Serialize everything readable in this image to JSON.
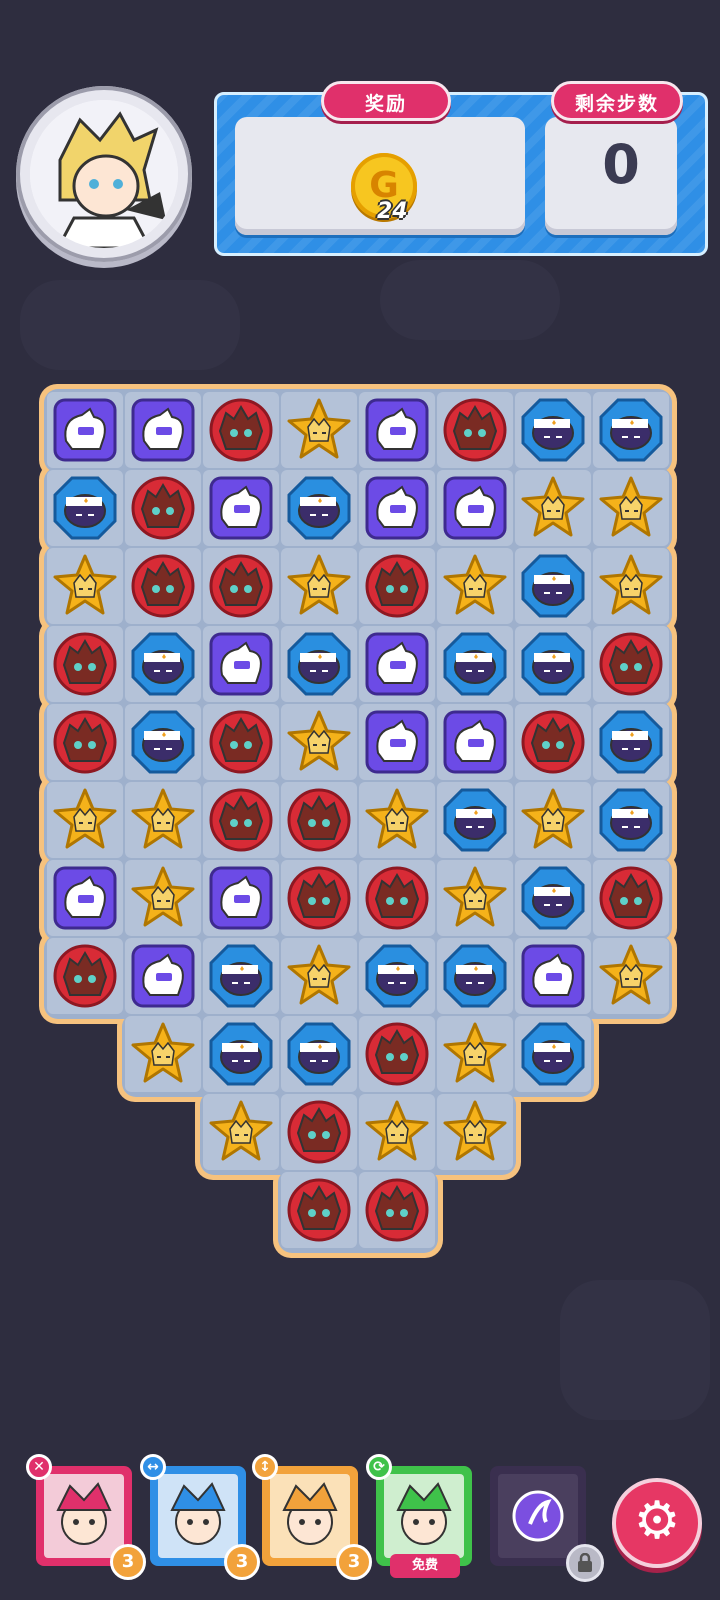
{
  "header": {
    "reward_label": "奖励",
    "steps_label": "剩余步数",
    "reward_count": "24",
    "coin_symbol": "G",
    "steps_value": "0"
  },
  "board": {
    "rows": [
      [
        "purple",
        "purple",
        "red",
        "yellow",
        "purple",
        "red",
        "blue",
        "blue"
      ],
      [
        "blue",
        "red",
        "purple",
        "blue",
        "purple",
        "purple",
        "yellow",
        "yellow"
      ],
      [
        "yellow",
        "red",
        "red",
        "yellow",
        "red",
        "yellow",
        "blue",
        "yellow"
      ],
      [
        "red",
        "blue",
        "purple",
        "blue",
        "purple",
        "blue",
        "blue",
        "red"
      ],
      [
        "red",
        "blue",
        "red",
        "yellow",
        "purple",
        "purple",
        "red",
        "blue"
      ],
      [
        "yellow",
        "yellow",
        "red",
        "red",
        "yellow",
        "blue",
        "yellow",
        "blue"
      ],
      [
        "purple",
        "yellow",
        "purple",
        "red",
        "red",
        "yellow",
        "blue",
        "red"
      ],
      [
        "red",
        "purple",
        "blue",
        "yellow",
        "blue",
        "blue",
        "purple",
        "yellow"
      ],
      [
        null,
        "yellow",
        "blue",
        "blue",
        "red",
        "yellow",
        "blue",
        null
      ],
      [
        null,
        null,
        "yellow",
        "red",
        "yellow",
        "yellow",
        null,
        null
      ],
      [
        null,
        null,
        null,
        "red",
        "red",
        null,
        null,
        null
      ]
    ],
    "colors": {
      "purple": "#6c4be6",
      "red": "#d82b36",
      "yellow": "#f5b21a",
      "blue": "#2a8fe0"
    }
  },
  "skills": [
    {
      "name": "clear",
      "border": "#e0306b",
      "icon": "close-icon",
      "icon_glyph": "✕",
      "badge_color": "#e0306b",
      "count": "3"
    },
    {
      "name": "swap-horizontal",
      "border": "#2f8fe6",
      "icon": "swap-horizontal-icon",
      "icon_glyph": "↔",
      "badge_color": "#2f8fe6",
      "count": "3"
    },
    {
      "name": "swap-vertical",
      "border": "#f2a23b",
      "icon": "swap-vertical-icon",
      "icon_glyph": "↕",
      "badge_color": "#f2a23b",
      "count": "3"
    },
    {
      "name": "refresh",
      "border": "#3fc24a",
      "icon": "refresh-icon",
      "icon_glyph": "⟳",
      "badge_color": "#3fc24a",
      "free_label": "免费"
    },
    {
      "name": "locked",
      "border": "#3a2f4f",
      "icon": "lock-icon",
      "icon_glyph": "🔒"
    }
  ],
  "settings_icon": "gear-icon"
}
